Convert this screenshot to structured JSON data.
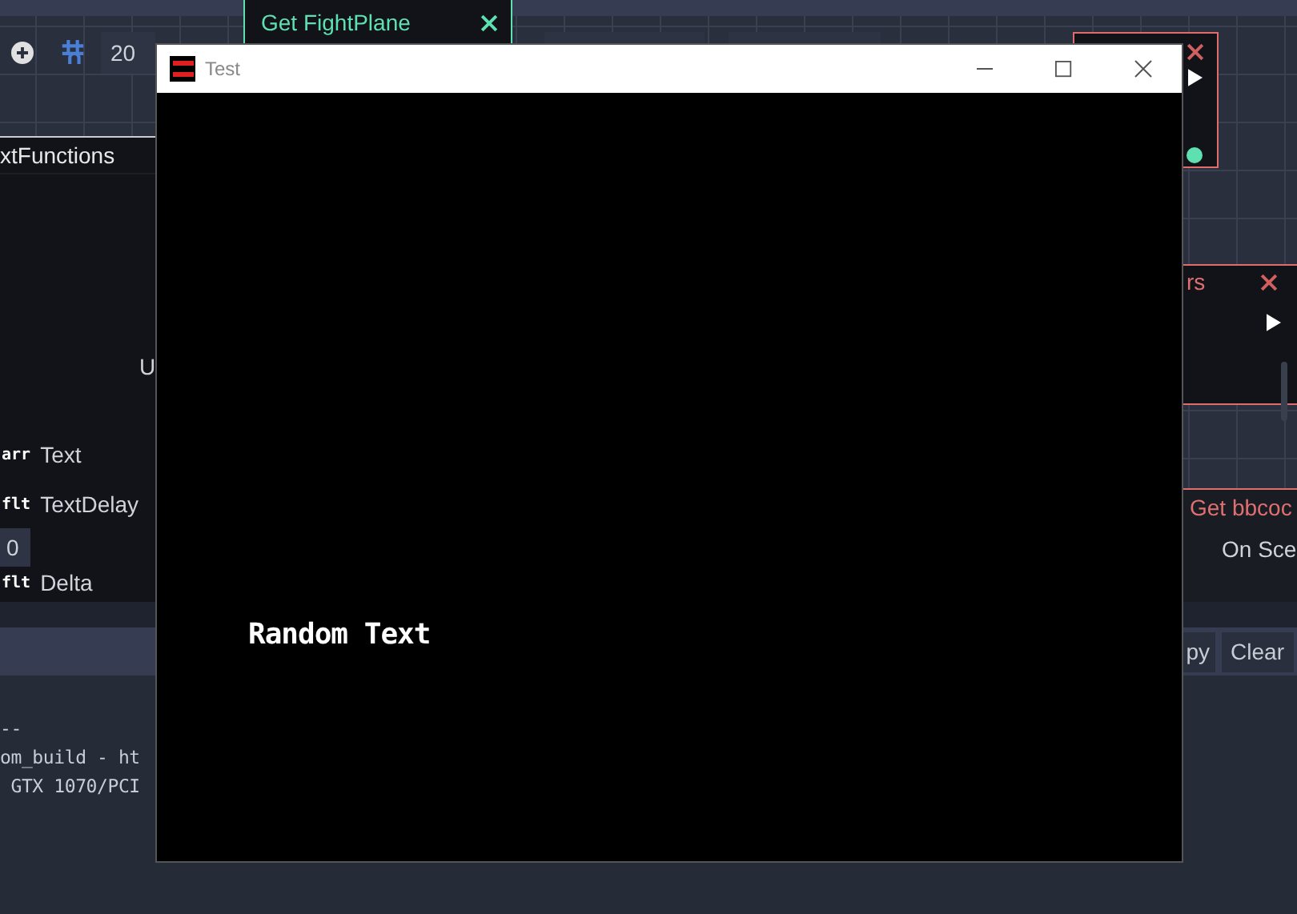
{
  "toolbar": {
    "snap_value": "20"
  },
  "nodes": {
    "fight_plane": {
      "title": "Get FightPlane"
    },
    "text_functions": {
      "title": "xtFunctions",
      "letter": "U",
      "ports": [
        {
          "type_label": "arr",
          "name": "Text"
        },
        {
          "type_label": "flt",
          "name": "TextDelay"
        },
        {
          "type_label": "flt",
          "name": "Delta"
        }
      ],
      "value": "0"
    },
    "right_middle": {
      "title": "rs"
    },
    "right_bottom": {
      "title": "Get bbcoc",
      "label": "On Sce"
    }
  },
  "output": {
    "buttons": [
      "py",
      "Clear"
    ],
    "lines": [
      "--",
      "om_build - ht",
      " GTX 1070/PCI"
    ]
  },
  "game_window": {
    "title": "Test",
    "content_text": "Random Text"
  }
}
